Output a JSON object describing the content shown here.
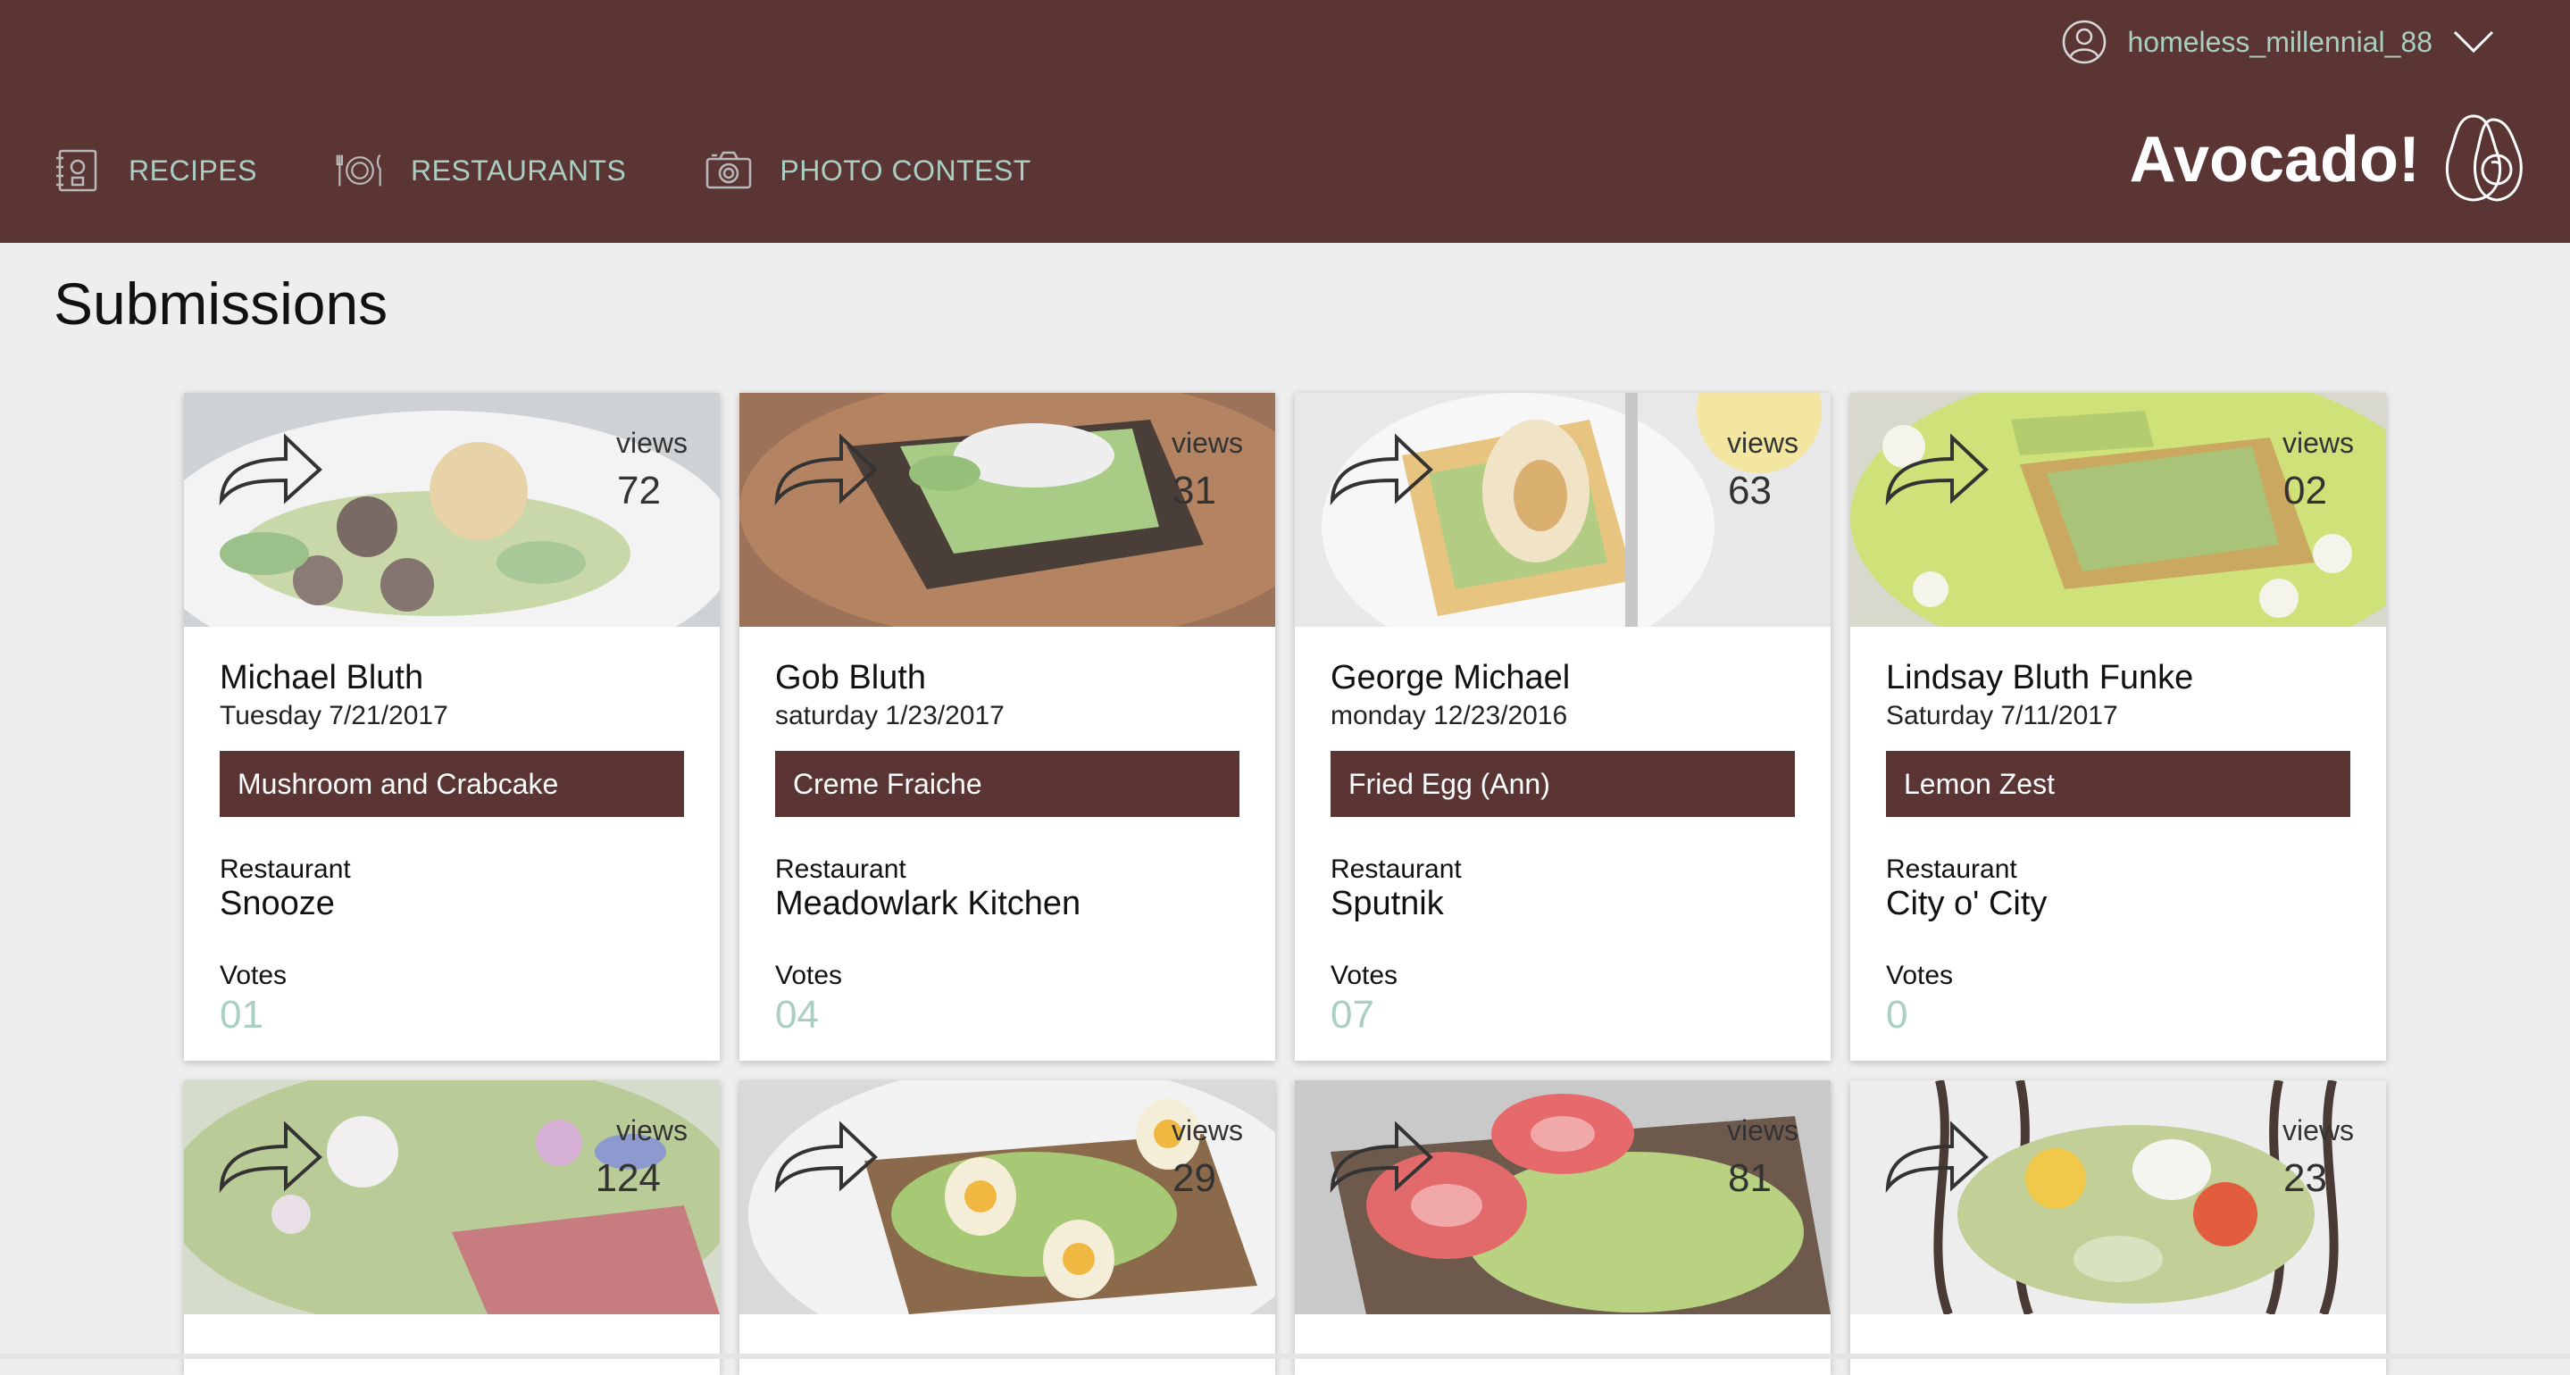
{
  "header": {
    "username": "homeless_millennial_88",
    "brand": "Avocado!",
    "nav": [
      {
        "label": "RECIPES",
        "icon": "recipe-book-icon"
      },
      {
        "label": "RESTAURANTS",
        "icon": "plate-cutlery-icon"
      },
      {
        "label": "PHOTO CONTEST",
        "icon": "camera-icon"
      }
    ]
  },
  "page": {
    "title": "Submissions"
  },
  "labels": {
    "views": "views",
    "restaurant": "Restaurant",
    "votes": "Votes"
  },
  "colors": {
    "header_bg": "#5b3534",
    "accent": "#a8cfc2",
    "page_bg": "#eeeeee"
  },
  "cards": [
    {
      "views": "72",
      "name": "Michael Bluth",
      "date": "Tuesday 7/21/2017",
      "dish": "Mushroom and Crabcake",
      "restaurant": "Snooze",
      "votes": "01"
    },
    {
      "views": "31",
      "name": "Gob Bluth",
      "date": "saturday 1/23/2017",
      "dish": "Creme Fraiche",
      "restaurant": "Meadowlark Kitchen",
      "votes": "04"
    },
    {
      "views": "63",
      "name": "George Michael",
      "date": "monday 12/23/2016",
      "dish": "Fried Egg (Ann)",
      "restaurant": "Sputnik",
      "votes": "07"
    },
    {
      "views": "02",
      "name": "Lindsay Bluth Funke",
      "date": "Saturday 7/11/2017",
      "dish": "Lemon Zest",
      "restaurant": "City o' City",
      "votes": "0"
    },
    {
      "views": "124"
    },
    {
      "views": "29"
    },
    {
      "views": "81"
    },
    {
      "views": "23"
    }
  ]
}
